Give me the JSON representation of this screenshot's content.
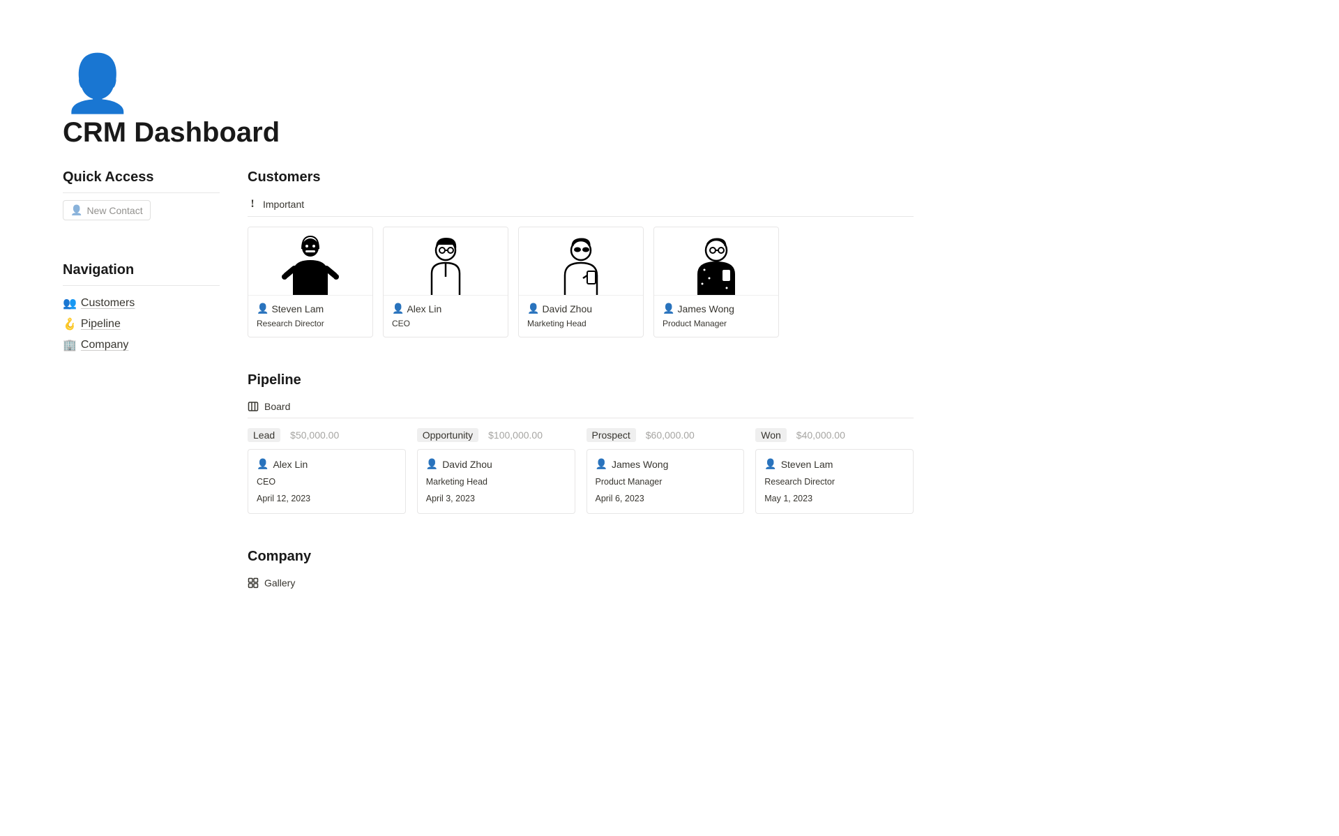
{
  "page": {
    "icon": "👤",
    "title": "CRM Dashboard"
  },
  "sidebar": {
    "quick_access_header": "Quick Access",
    "new_contact_label": "New Contact",
    "navigation_header": "Navigation",
    "nav_items": [
      {
        "emoji": "👥",
        "label": "Customers"
      },
      {
        "emoji": "🪝",
        "label": "Pipeline"
      },
      {
        "emoji": "🏢",
        "label": "Company"
      }
    ]
  },
  "customers": {
    "header": "Customers",
    "view_label": "Important",
    "items": [
      {
        "name": "Steven Lam",
        "role": "Research Director"
      },
      {
        "name": "Alex Lin",
        "role": "CEO"
      },
      {
        "name": "David Zhou",
        "role": "Marketing Head"
      },
      {
        "name": "James Wong",
        "role": "Product Manager"
      }
    ]
  },
  "pipeline": {
    "header": "Pipeline",
    "view_label": "Board",
    "columns": [
      {
        "tag": "Lead",
        "amount": "$50,000.00",
        "card": {
          "name": "Alex Lin",
          "role": "CEO",
          "date": "April 12, 2023"
        }
      },
      {
        "tag": "Opportunity",
        "amount": "$100,000.00",
        "card": {
          "name": "David Zhou",
          "role": "Marketing Head",
          "date": "April 3, 2023"
        }
      },
      {
        "tag": "Prospect",
        "amount": "$60,000.00",
        "card": {
          "name": "James Wong",
          "role": "Product Manager",
          "date": "April 6, 2023"
        }
      },
      {
        "tag": "Won",
        "amount": "$40,000.00",
        "card": {
          "name": "Steven Lam",
          "role": "Research Director",
          "date": "May 1, 2023"
        }
      }
    ]
  },
  "company": {
    "header": "Company",
    "view_label": "Gallery"
  }
}
